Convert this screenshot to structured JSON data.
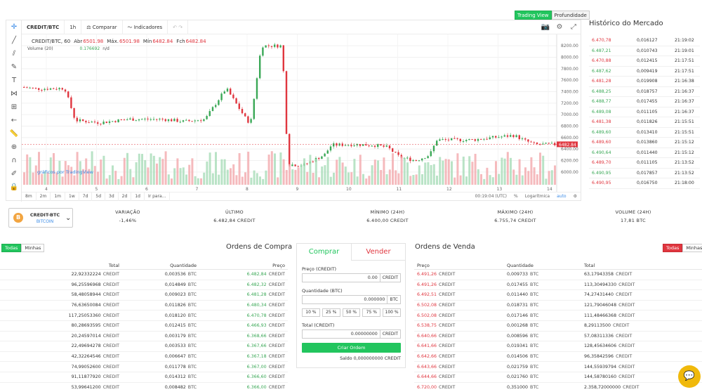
{
  "chart_toggle": {
    "trading_view": "Trading View",
    "depth": "Profundidade"
  },
  "toolbar": {
    "symbol": "CREDIT/BTC",
    "interval": "1h",
    "compare": "Comparar",
    "indicators": "Indicadores"
  },
  "legend": {
    "line1_symbol": "CREDIT/BTC, 60",
    "open_label": "Abr",
    "open_value": "6501.98",
    "high_label": "Máx.",
    "high_value": "6501.98",
    "low_label": "Mín",
    "low_value": "6482.84",
    "close_label": "Fch",
    "close_value": "6482.84",
    "volume_label": "Volume (20)",
    "volume_value": "0.176692",
    "volume_na": "n/d",
    "watermark": "gráficos por TradingView"
  },
  "bottom_toolbar": {
    "periods": [
      "8m",
      "2m",
      "1m",
      "1w",
      "7d",
      "5d",
      "3d",
      "2d",
      "1d",
      "Ir para..."
    ],
    "time": "00:19:04 (UTC)",
    "pct": "%",
    "log": "Logarítmica",
    "auto": "auto"
  },
  "chart_data": {
    "type": "candlestick",
    "y_ticks": [
      "8200.00",
      "8000.00",
      "7800.00",
      "7600.00",
      "7400.00",
      "7200.00",
      "7000.00",
      "6800.00",
      "6600.00",
      "6400.00",
      "6200.00",
      "6000.00"
    ],
    "x_ticks": [
      "4",
      "5",
      "6",
      "7",
      "8",
      "9",
      "10",
      "11",
      "12",
      "13",
      "14"
    ],
    "last_price_label": "6482.84",
    "ylim": [
      5900,
      8300
    ],
    "colors": {
      "up": "#3aa856",
      "down": "#e0363f",
      "vol_up": "#a8dcb8",
      "vol_down": "#f3a9ad"
    }
  },
  "market_history": {
    "title": "Histórico do Mercado",
    "rows": [
      {
        "price": "6.470,78",
        "qty": "0,016127",
        "time": "21:19:02",
        "side": "red"
      },
      {
        "price": "6.487,21",
        "qty": "0,010743",
        "time": "21:19:01",
        "side": "green"
      },
      {
        "price": "6.470,88",
        "qty": "0,012415",
        "time": "21:17:51",
        "side": "red"
      },
      {
        "price": "6.487,62",
        "qty": "0,009419",
        "time": "21:17:51",
        "side": "green"
      },
      {
        "price": "6.481,28",
        "qty": "0,019908",
        "time": "21:16:38",
        "side": "red"
      },
      {
        "price": "6.488,25",
        "qty": "0,018757",
        "time": "21:16:37",
        "side": "green"
      },
      {
        "price": "6.488,77",
        "qty": "0,017455",
        "time": "21:16:37",
        "side": "green"
      },
      {
        "price": "6.489,08",
        "qty": "0,011105",
        "time": "21:16:37",
        "side": "green"
      },
      {
        "price": "6.481,38",
        "qty": "0,011826",
        "time": "21:15:51",
        "side": "red"
      },
      {
        "price": "6.489,60",
        "qty": "0,013410",
        "time": "21:15:51",
        "side": "green"
      },
      {
        "price": "6.489,60",
        "qty": "0,013860",
        "time": "21:15:12",
        "side": "red"
      },
      {
        "price": "6.490,64",
        "qty": "0,011440",
        "time": "21:15:12",
        "side": "green"
      },
      {
        "price": "6.489,70",
        "qty": "0,011105",
        "time": "21:13:52",
        "side": "red"
      },
      {
        "price": "6.490,95",
        "qty": "0,017857",
        "time": "21:13:52",
        "side": "green"
      },
      {
        "price": "6.490,95",
        "qty": "0,016750",
        "time": "21:18:00",
        "side": "red"
      }
    ]
  },
  "pair": {
    "name": "CREDIT-BTC",
    "sub": "BITCOIN",
    "coin_symbol": "B"
  },
  "stats": [
    {
      "label": "VARIAÇÃO",
      "value": "-1,46%",
      "color": "red"
    },
    {
      "label": "ÚLTIMO",
      "value": "6.482,84 CREDIT",
      "color": ""
    },
    {
      "label": "MÍNIMO (24H)",
      "value": "6.400,00 CREDIT",
      "color": ""
    },
    {
      "label": "MÁXIMO (24H)",
      "value": "6.755,74 CREDIT",
      "color": ""
    },
    {
      "label": "VOLUME (24H)",
      "value": "17,81 BTC",
      "color": ""
    }
  ],
  "buy_book": {
    "title": "Ordens de Compra",
    "filter_all": "Todas",
    "filter_mine": "Minhas",
    "headers": [
      "Total",
      "Quantidade",
      "Preço"
    ],
    "rows": [
      {
        "total": "22,92332224",
        "qty": "0,003536",
        "price": "6.482,84"
      },
      {
        "total": "96,25596968",
        "qty": "0,014849",
        "price": "6.482,32"
      },
      {
        "total": "58,48058944",
        "qty": "0,009023",
        "price": "6.481,28"
      },
      {
        "total": "76,63650084",
        "qty": "0,011826",
        "price": "6.480,34"
      },
      {
        "total": "117,25053360",
        "qty": "0,018120",
        "price": "6.470,78"
      },
      {
        "total": "80,28693595",
        "qty": "0,012415",
        "price": "6.466,93"
      },
      {
        "total": "20,24597014",
        "qty": "0,003179",
        "price": "6.368,66"
      },
      {
        "total": "22,49694278",
        "qty": "0,003533",
        "price": "6.367,66"
      },
      {
        "total": "42,32264546",
        "qty": "0,006647",
        "price": "6.367,18"
      },
      {
        "total": "74,99052600",
        "qty": "0,011778",
        "price": "6.367,00"
      },
      {
        "total": "91,11877920",
        "qty": "0,014312",
        "price": "6.366,60"
      },
      {
        "total": "53,99641200",
        "qty": "0,008482",
        "price": "6.366,00"
      }
    ]
  },
  "sell_book": {
    "title": "Ordens de Venda",
    "filter_all": "Todas",
    "filter_mine": "Minhas",
    "headers": [
      "Preço",
      "Quantidade",
      "Total"
    ],
    "rows": [
      {
        "price": "6.491,26",
        "qty": "0,009733",
        "total": "63,17943358"
      },
      {
        "price": "6.491,26",
        "qty": "0,017455",
        "total": "113,30494330"
      },
      {
        "price": "6.492,51",
        "qty": "0,011440",
        "total": "74,27431440"
      },
      {
        "price": "6.502,08",
        "qty": "0,018731",
        "total": "121,79046048"
      },
      {
        "price": "6.502,08",
        "qty": "0,017146",
        "total": "111,48466368"
      },
      {
        "price": "6.538,75",
        "qty": "0,001268",
        "total": "8,29113500"
      },
      {
        "price": "6.640,66",
        "qty": "0,008596",
        "total": "57,08311336"
      },
      {
        "price": "6.641,66",
        "qty": "0,019341",
        "total": "128,45634606"
      },
      {
        "price": "6.642,66",
        "qty": "0,014506",
        "total": "96,35842596"
      },
      {
        "price": "6.643,66",
        "qty": "0,021759",
        "total": "144,55939794"
      },
      {
        "price": "6.644,66",
        "qty": "0,021760",
        "total": "144,58780160"
      },
      {
        "price": "6.720,00",
        "qty": "0,351000",
        "total": "2.358,72000000"
      }
    ]
  },
  "units": {
    "credit": "CREDIT",
    "btc": "BTC"
  },
  "order_form": {
    "tab_buy": "Comprar",
    "tab_sell": "Vender",
    "price_label": "Preço (CREDIT)",
    "price_value": "0.00",
    "price_unit": "CREDIT",
    "qty_label": "Quantidade (BTC)",
    "qty_value": "0.000000",
    "qty_unit": "BTC",
    "pcts": [
      "10 %",
      "25 %",
      "50 %",
      "75 %",
      "100 %"
    ],
    "total_label": "Total (CREDIT)",
    "total_value": "0.00000000",
    "total_unit": "CREDIT",
    "submit": "Criar Ordem",
    "balance_label": "Saldo",
    "balance_value": "0,000000000",
    "balance_unit": "CREDIT"
  }
}
